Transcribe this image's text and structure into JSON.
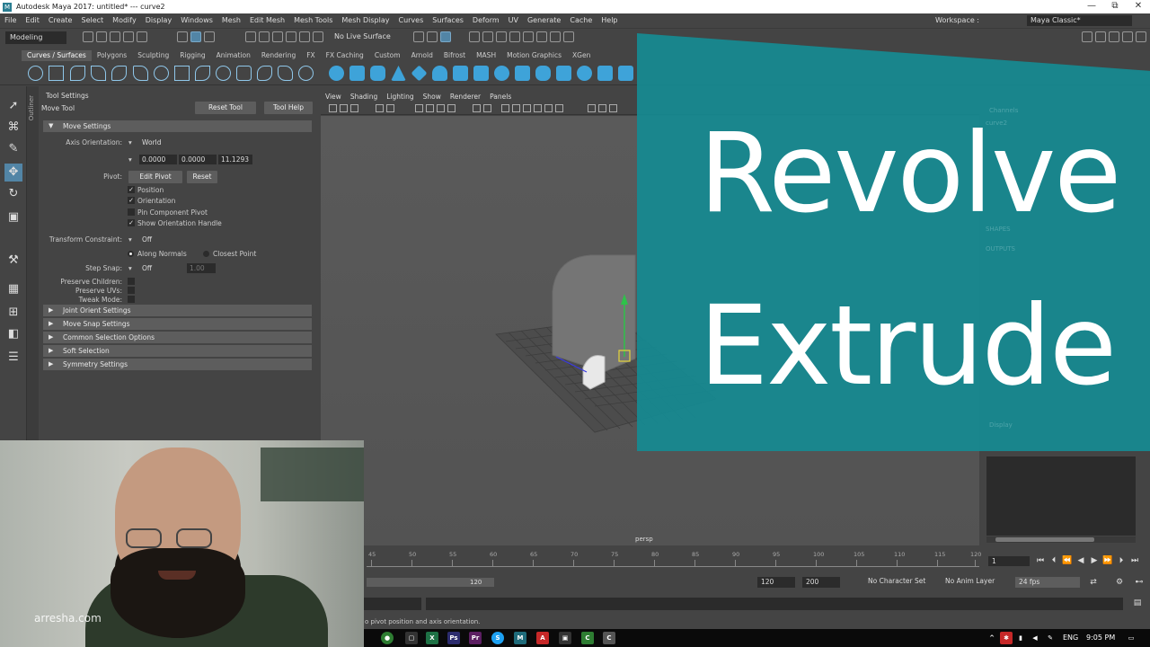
{
  "titlebar": {
    "title": "Autodesk Maya 2017: untitled*   ---   curve2",
    "min": "—",
    "restore": "⧉",
    "close": "✕"
  },
  "menu": [
    "File",
    "Edit",
    "Create",
    "Select",
    "Modify",
    "Display",
    "Windows",
    "Mesh",
    "Edit Mesh",
    "Mesh Tools",
    "Mesh Display",
    "Curves",
    "Surfaces",
    "Deform",
    "UV",
    "Generate",
    "Cache",
    "Help"
  ],
  "workspace": {
    "label": "Workspace :",
    "value": "Maya Classic*"
  },
  "status": {
    "mode": "Modeling",
    "live_surface": "No Live Surface"
  },
  "shelf_tabs": [
    "Curves / Surfaces",
    "Polygons",
    "Sculpting",
    "Rigging",
    "Animation",
    "Rendering",
    "FX",
    "FX Caching",
    "Custom",
    "Arnold",
    "Bifrost",
    "MASH",
    "Motion Graphics",
    "XGen"
  ],
  "tool_settings": {
    "panel_title": "Tool Settings",
    "tool_name": "Move Tool",
    "reset_tool": "Reset Tool",
    "tool_help": "Tool Help",
    "move_settings": "Move Settings",
    "axis_orientation_label": "Axis Orientation:",
    "axis_orientation_value": "World",
    "coords": [
      "0.0000",
      "0.0000",
      "11.1293"
    ],
    "pivot_label": "Pivot:",
    "edit_pivot": "Edit Pivot",
    "reset": "Reset",
    "position": "Position",
    "orientation": "Orientation",
    "pin_component_pivot": "Pin Component Pivot",
    "show_orientation_handle": "Show Orientation Handle",
    "transform_constraint_label": "Transform Constraint:",
    "transform_constraint_value": "Off",
    "along_normals": "Along Normals",
    "closest_point": "Closest Point",
    "step_snap_label": "Step Snap:",
    "step_snap_value": "Off",
    "step_snap_num": "1.00",
    "preserve_children": "Preserve Children:",
    "preserve_uvs": "Preserve UVs:",
    "tweak_mode": "Tweak Mode:",
    "sections": [
      "Joint Orient Settings",
      "Move Snap Settings",
      "Common Selection Options",
      "Soft Selection",
      "Symmetry Settings"
    ]
  },
  "outliner_label": "Outliner",
  "viewport": {
    "menu": [
      "View",
      "Shading",
      "Lighting",
      "Show",
      "Renderer",
      "Panels"
    ],
    "camera": "persp"
  },
  "title_card": {
    "line1": "Revolve",
    "line2": "Extrude"
  },
  "timeline": {
    "ticks": [
      "45",
      "50",
      "55",
      "60",
      "65",
      "70",
      "75",
      "80",
      "85",
      "90",
      "95",
      "100",
      "105",
      "110",
      "115",
      "120"
    ],
    "current_frame": "1",
    "range_end_inner": "120",
    "range_end": "120",
    "anim_end": "200",
    "character_set": "No Character Set",
    "anim_layer": "No Anim Layer",
    "fps": "24 fps"
  },
  "helpline": "Move Tool: Use manipulator to move object(s). Ctrl+middle-drag to move components along constrained axis. Use D or INSERT to change the pivot position and axis orientation.",
  "helpline_visible": "o pivot position and axis orientation.",
  "taskbar": {
    "lang": "ENG",
    "time": "9:05 PM"
  },
  "watermark": "arresha.com",
  "colors": {
    "accent": "#5285a6",
    "card": "#168a91"
  }
}
